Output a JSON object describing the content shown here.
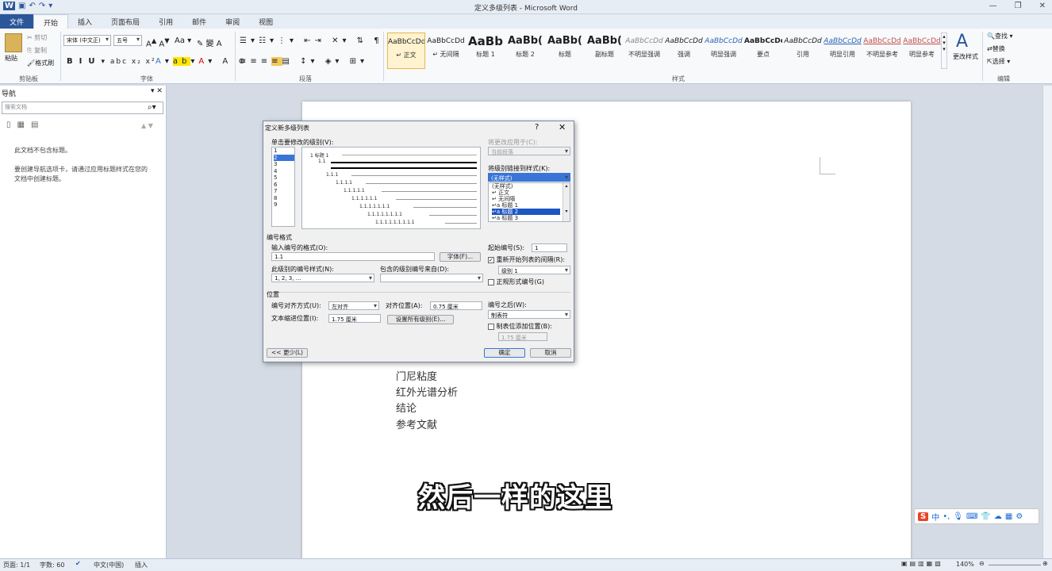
{
  "window": {
    "title": "定义多级列表 - Microsoft Word",
    "controls": [
      "—",
      "❐",
      "✕"
    ]
  },
  "qat": {
    "icons": [
      "W",
      "💾",
      "↶",
      "↷",
      "⎘"
    ]
  },
  "tabs": [
    "文件",
    "开始",
    "插入",
    "页面布局",
    "引用",
    "邮件",
    "审阅",
    "视图"
  ],
  "ribbon": {
    "clipboard": {
      "paste": "粘贴",
      "cut": "剪切",
      "copy": "复制",
      "painter": "格式刷",
      "label": "剪贴板"
    },
    "font": {
      "name": "宋体 (中文正)",
      "size": "五号",
      "label": "字体",
      "btns": [
        "A",
        "A",
        "Aa",
        "B",
        "I",
        "U",
        "abc",
        "x₂",
        "x²",
        "A",
        "ab",
        "A",
        "A",
        "A"
      ]
    },
    "paragraph": {
      "label": "段落"
    },
    "styles": {
      "label": "样式",
      "items": [
        {
          "pv": "AaBbCcDd",
          "nm": "↵ 正文"
        },
        {
          "pv": "AaBbCcDd",
          "nm": "↵ 无间隔"
        },
        {
          "pv": "AaBb",
          "nm": "标题 1"
        },
        {
          "pv": "AaBb(",
          "nm": "标题 2"
        },
        {
          "pv": "AaBb(",
          "nm": "标题"
        },
        {
          "pv": "AaBb(",
          "nm": "副标题"
        },
        {
          "pv": "AaBbCcDd",
          "nm": "不明显强调"
        },
        {
          "pv": "AaBbCcDd",
          "nm": "强调"
        },
        {
          "pv": "AaBbCcDd",
          "nm": "明显强调"
        },
        {
          "pv": "AaBbCcDd",
          "nm": "要点"
        },
        {
          "pv": "AaBbCcDd",
          "nm": "引用"
        },
        {
          "pv": "AaBbCcDd",
          "nm": "明显引用"
        },
        {
          "pv": "AaBbCcDd",
          "nm": "不明显参考"
        },
        {
          "pv": "AaBbCcDd",
          "nm": "明显参考"
        }
      ],
      "change": "更改样式"
    },
    "editing": {
      "label": "编辑",
      "find": "查找",
      "replace": "替换",
      "select": "选择"
    }
  },
  "nav": {
    "title": "导航",
    "search_placeholder": "搜索文档",
    "msg1": "此文档不包含标题。",
    "msg2": "要创建导航选项卡，请通过应用标题样式在您的文档中创建标题。"
  },
  "doc": {
    "lines": [
      "门尼粘度",
      "红外光谱分析",
      "结论",
      "参考文献"
    ]
  },
  "dialog": {
    "title": "定义新多级列表",
    "help": "?",
    "close": "✕",
    "click_level": "单击要修改的级别(V):",
    "levels": [
      "1",
      "2",
      "3",
      "4",
      "5",
      "6",
      "7",
      "8",
      "9"
    ],
    "selected_level": "2",
    "preview": [
      "1  标题 1",
      "1.1",
      "1.1.1",
      "1.1.1.1",
      "1.1.1.1.1",
      "1.1.1.1.1.1",
      "1.1.1.1.1.1.1",
      "1.1.1.1.1.1.1.1",
      "1.1.1.1.1.1.1.1.1"
    ],
    "apply_to_label": "将更改应用于(C):",
    "apply_to_value": "当前段落",
    "link_label": "将级别链接到样式(K):",
    "link_value": "(无样式)",
    "link_options": [
      "(无样式)",
      "↵ 正文",
      "↵ 无间隔",
      "↵a 标题 1",
      "↵a 标题 2",
      "↵a 标题 3"
    ],
    "link_selected": "↵a 标题 2",
    "number_format": "编号格式",
    "enter_format_label": "输入编号的格式(O):",
    "enter_format_value": "1.1",
    "font_btn": "字体(F)...",
    "style_label": "此级别的编号样式(N):",
    "style_value": "1, 2, 3, …",
    "include_label": "包含的级别编号来自(D):",
    "include_value": "",
    "start_label": "起始编号(S):",
    "start_value": "1",
    "restart_label": "重新开始列表的间隔(R):",
    "restart_value": "级别 1",
    "legal_label": "正规形式编号(G)",
    "position": "位置",
    "align_label": "编号对齐方式(U):",
    "align_value": "左对齐",
    "alignat_label": "对齐位置(A):",
    "alignat_value": "0.75 厘米",
    "indent_label": "文本缩进位置(I):",
    "indent_value": "1.75 厘米",
    "setall_btn": "设置所有级别(E)...",
    "follow_label": "编号之后(W):",
    "follow_value": "制表符",
    "tabstop_label": "制表位添加位置(B):",
    "tabstop_value": "1.75 厘米",
    "less_btn": "<< 更少(L)",
    "ok_btn": "确定",
    "cancel_btn": "取消"
  },
  "subtitle": "然后一样的这里",
  "status": {
    "page": "页面: 1/1",
    "words": "字数: 60",
    "lang": "中文(中国)",
    "insert": "插入",
    "zoom": "140%"
  },
  "ime": {
    "logo": "S",
    "mode": "中"
  }
}
